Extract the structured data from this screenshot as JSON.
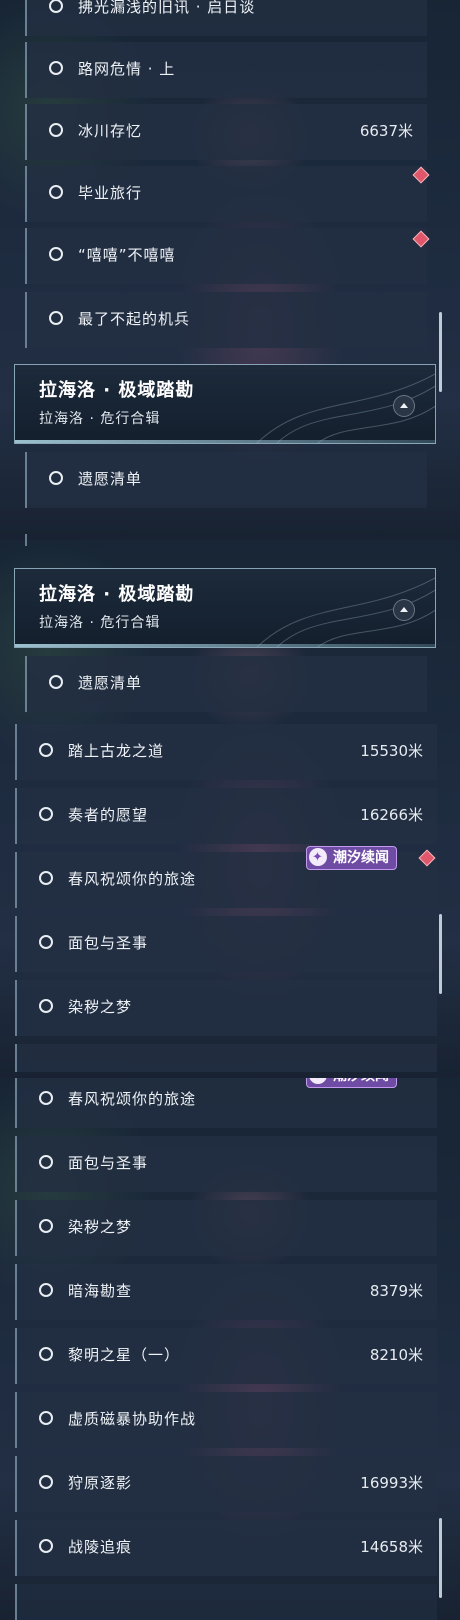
{
  "header": {
    "title": "拉海洛 · 极域踏勘",
    "subtitle": "拉海洛 · 危行合辑"
  },
  "badge_label": "潮汐续闻",
  "panel1": {
    "partial_top": "拂光漏浅的旧讯 · 启日谈",
    "items": [
      {
        "label": "路网危情 · 上",
        "distance": ""
      },
      {
        "label": "冰川存忆",
        "distance": "6637米"
      },
      {
        "label": "毕业旅行",
        "distance": ""
      },
      {
        "label": "“嘻嘻”不嘻嘻",
        "distance": ""
      },
      {
        "label": "最了不起的机兵",
        "distance": ""
      }
    ],
    "after_header": {
      "label": "遗愿清单"
    }
  },
  "panel2": {
    "first": {
      "label": "遗愿清单"
    },
    "items": [
      {
        "label": "踏上古龙之道",
        "distance": "15530米"
      },
      {
        "label": "奏者的愿望",
        "distance": "16266米"
      },
      {
        "label": "春风祝颂你的旅途",
        "distance": ""
      },
      {
        "label": "面包与圣事",
        "distance": ""
      },
      {
        "label": "染秽之梦",
        "distance": ""
      }
    ]
  },
  "panel3": {
    "items": [
      {
        "label": "春风祝颂你的旅途",
        "distance": ""
      },
      {
        "label": "面包与圣事",
        "distance": ""
      },
      {
        "label": "染秽之梦",
        "distance": ""
      },
      {
        "label": "暗海勘查",
        "distance": "8379米"
      },
      {
        "label": "黎明之星（一）",
        "distance": "8210米"
      },
      {
        "label": "虚质磁暴协助作战",
        "distance": ""
      },
      {
        "label": "狩原逐影",
        "distance": "16993米"
      },
      {
        "label": "战陵追痕",
        "distance": "14658米"
      }
    ]
  },
  "colors": {
    "accent_border": "#a5c3d7",
    "row_bg": "#222e42",
    "marker_red": "#e0566a",
    "badge_purple": "#7850af"
  },
  "icons": [
    "incomplete-circle-icon",
    "tracked-quest-diamond-icon",
    "collapse-arrow-icon",
    "tidal-sequel-star-icon"
  ]
}
